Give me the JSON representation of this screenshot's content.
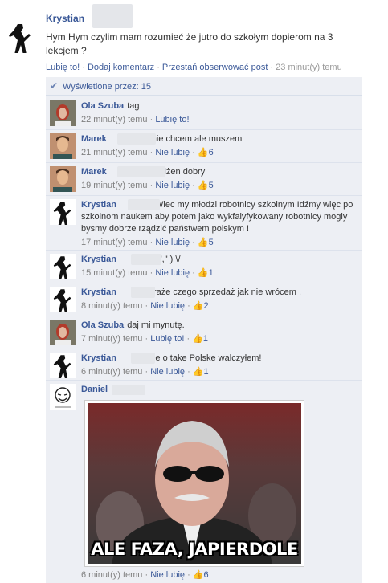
{
  "post": {
    "author": "Krystian",
    "text": "Hym Hym czylim mam rozumieć że jutro do szkołym dopierom na 3 lekcjem ?",
    "actions": {
      "like": "Lubię to!",
      "comment": "Dodaj komentarz",
      "unfollow": "Przestań obserwować post",
      "time": "23 minut(y) temu",
      "sep": " · "
    }
  },
  "seen": {
    "label": "Wyświetlone przez: 15"
  },
  "comments": [
    {
      "name": "Ola Szuba",
      "text": "tag",
      "time": "22 minut(y) temu",
      "action": "Lubię to!",
      "likes": ""
    },
    {
      "name": "Marek",
      "text": "nie chcem ale muszem",
      "time": "21 minut(y) temu",
      "action": "Nie lubię",
      "likes": "6"
    },
    {
      "name": "Marek",
      "text": "dżen dobry",
      "time": "19 minut(y) temu",
      "action": "Nie lubię",
      "likes": "5"
    },
    {
      "name": "Krystian",
      "text": "Wiec my młodzi robotnicy szkolnym Idźmy więc po szkolnom naukem aby potem jako wykfalyfykowany robotnicy mogly bysmy dobrze rządzić państwem polskym !",
      "time": "17 minut(y) temu",
      "action": "Nie lubię",
      "likes": "5"
    },
    {
      "name": "Krystian",
      "text": "( \",\" ) \\/",
      "time": "15 minut(y) temu",
      "action": "Nie lubię",
      "likes": "1"
    },
    {
      "name": "Krystian",
      "text": "wraże czego sprzedaż jak nie wrócem .",
      "time": "8 minut(y) temu",
      "action": "Nie lubię",
      "likes": "2"
    },
    {
      "name": "Ola Szuba",
      "text": "daj mi mynutę.",
      "time": "7 minut(y) temu",
      "action": "Lubię to!",
      "likes": "1"
    },
    {
      "name": "Krystian",
      "text": "Nie o take Polske walczyłem!",
      "time": "6 minut(y) temu",
      "action": "Nie lubię",
      "likes": "1"
    }
  ],
  "last": {
    "name": "Daniel",
    "meme_caption": "ALE FAZA, JAPIERDOLE",
    "time": "6 minut(y) temu",
    "action": "Nie lubię",
    "likes": "6"
  },
  "icons": {
    "seen": "check-icon",
    "like": "thumbs-up-icon"
  }
}
